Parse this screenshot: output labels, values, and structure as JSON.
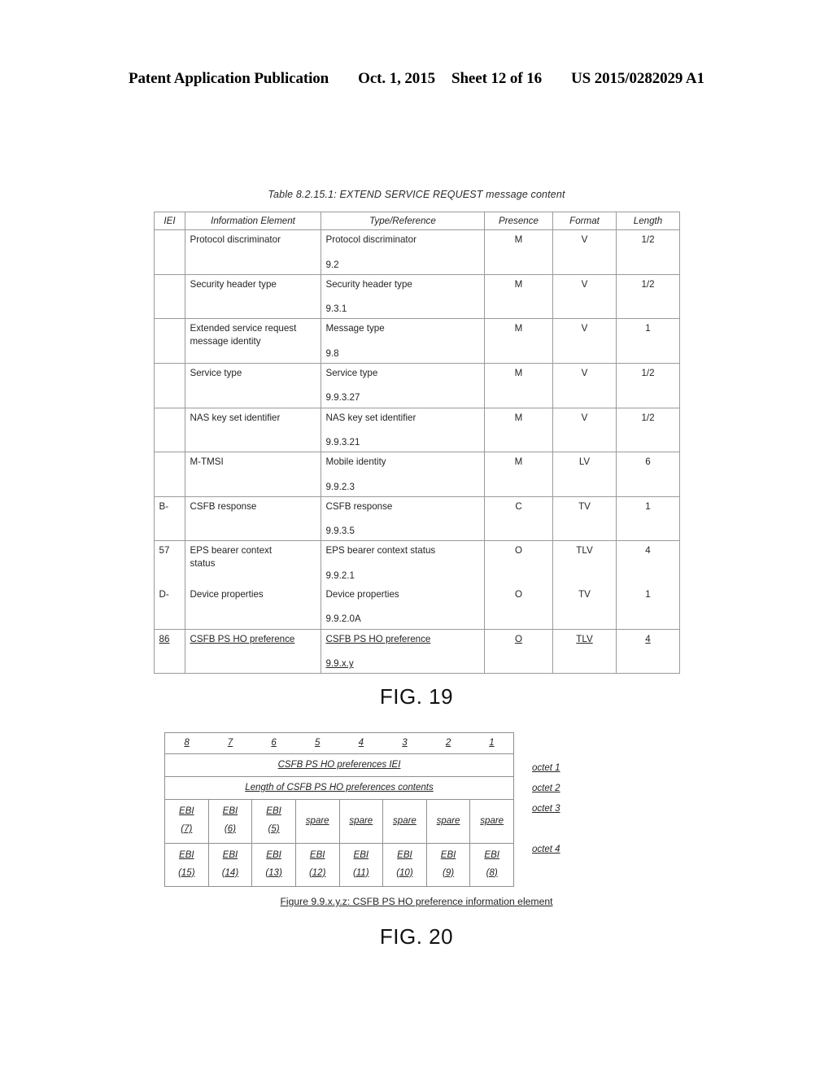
{
  "header": {
    "publication": "Patent Application Publication",
    "date": "Oct. 1, 2015",
    "sheet": "Sheet 12 of 16",
    "patent_number": "US 2015/0282029 A1"
  },
  "fig19": {
    "label": "FIG. 19",
    "table_caption": "Table 8.2.15.1: EXTEND SERVICE REQUEST message content",
    "columns": [
      "IEI",
      "Information Element",
      "Type/Reference",
      "Presence",
      "Format",
      "Length"
    ],
    "rows": [
      {
        "iei": "",
        "information_element": "Protocol discriminator",
        "type": "Protocol discriminator",
        "reference": "9.2",
        "presence": "M",
        "format": "V",
        "length": "1/2",
        "underlined": false
      },
      {
        "iei": "",
        "information_element": "Security header type",
        "type": "Security header type",
        "reference": "9.3.1",
        "presence": "M",
        "format": "V",
        "length": "1/2",
        "underlined": false
      },
      {
        "iei": "",
        "information_element": "Extended service request",
        "information_element_line2": "message identity",
        "type": "Message type",
        "reference": "9.8",
        "presence": "M",
        "format": "V",
        "length": "1",
        "underlined": false
      },
      {
        "iei": "",
        "information_element": "Service type",
        "type": "Service type",
        "reference": "9.9.3.27",
        "presence": "M",
        "format": "V",
        "length": "1/2",
        "underlined": false
      },
      {
        "iei": "",
        "information_element": "NAS key set identifier",
        "type": "NAS key set identifier",
        "reference": "9.9.3.21",
        "presence": "M",
        "format": "V",
        "length": "1/2",
        "underlined": false
      },
      {
        "iei": "",
        "information_element": "M-TMSI",
        "type": "Mobile identity",
        "reference": "9.9.2.3",
        "presence": "M",
        "format": "LV",
        "length": "6",
        "underlined": false
      },
      {
        "iei": "B-",
        "information_element": "CSFB response",
        "type": "CSFB response",
        "reference": "9.9.3.5",
        "presence": "C",
        "format": "TV",
        "length": "1",
        "underlined": false
      },
      {
        "iei": "57",
        "information_element": "EPS bearer context",
        "information_element_line2": "status",
        "type": "EPS bearer context status",
        "reference": "9.9.2.1",
        "presence": "O",
        "format": "TLV",
        "length": "4",
        "underlined": false
      },
      {
        "iei": "D-",
        "information_element": "Device properties",
        "type": "Device properties",
        "reference": "9.9.2.0A",
        "presence": "O",
        "format": "TV",
        "length": "1",
        "underlined": false
      },
      {
        "iei": "86",
        "information_element": "CSFB PS HO preference",
        "type": "CSFB PS HO preference",
        "reference": "9.9.x.y",
        "presence": "O",
        "format": "TLV",
        "length": "4",
        "underlined": true
      }
    ]
  },
  "fig20": {
    "label": "FIG. 20",
    "figure_caption": "Figure 9.9.x.y.z: CSFB PS HO preference information element",
    "bit_headers": [
      "8",
      "7",
      "6",
      "5",
      "4",
      "3",
      "2",
      "1"
    ],
    "octet1_label": "CSFB PS HO preferences IEI",
    "octet2_label": "Length of CSFB PS HO preferences contents",
    "octet3_cells": [
      {
        "label": "EBI",
        "number": "(7)",
        "type": "ebi"
      },
      {
        "label": "EBI",
        "number": "(6)",
        "type": "ebi"
      },
      {
        "label": "EBI",
        "number": "(5)",
        "type": "ebi"
      },
      {
        "label": "spare",
        "number": "",
        "type": "spare"
      },
      {
        "label": "spare",
        "number": "",
        "type": "spare"
      },
      {
        "label": "spare",
        "number": "",
        "type": "spare"
      },
      {
        "label": "spare",
        "number": "",
        "type": "spare"
      },
      {
        "label": "spare",
        "number": "",
        "type": "spare"
      }
    ],
    "octet4_cells": [
      {
        "label": "EBI",
        "number": "(15)",
        "type": "ebi"
      },
      {
        "label": "EBI",
        "number": "(14)",
        "type": "ebi"
      },
      {
        "label": "EBI",
        "number": "(13)",
        "type": "ebi"
      },
      {
        "label": "EBI",
        "number": "(12)",
        "type": "ebi"
      },
      {
        "label": "EBI",
        "number": "(11)",
        "type": "ebi"
      },
      {
        "label": "EBI",
        "number": "(10)",
        "type": "ebi"
      },
      {
        "label": "EBI",
        "number": "(9)",
        "type": "ebi"
      },
      {
        "label": "EBI",
        "number": "(8)",
        "type": "ebi"
      }
    ],
    "octet_labels": [
      "octet 1",
      "octet 2",
      "octet 3",
      "octet 4"
    ]
  }
}
